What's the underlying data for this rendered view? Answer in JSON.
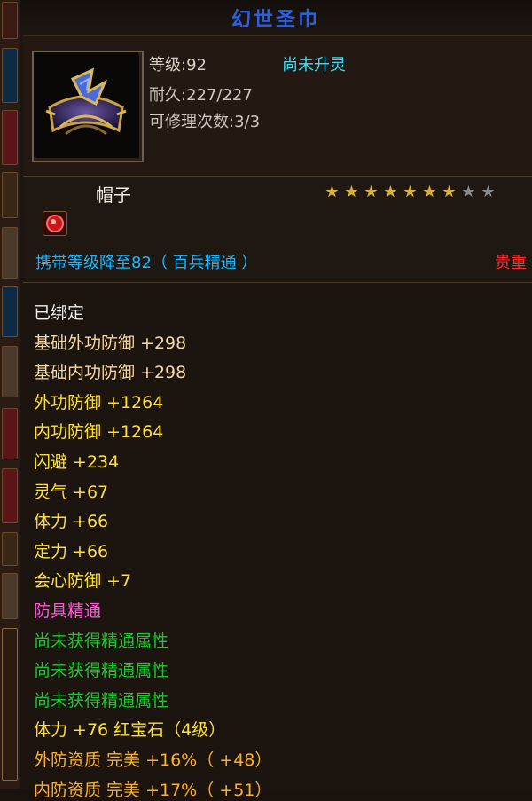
{
  "title": "幻世圣巾",
  "header": {
    "level": "等级:92",
    "spirit": "尚未升灵",
    "durability": "耐久:227/227",
    "repair": "可修理次数:3/3"
  },
  "item_type": "帽子",
  "stars": {
    "filled": 7,
    "total": 9
  },
  "carry_text": "携带等级降至82（ 百兵精通 ）",
  "precious": "贵重",
  "props": [
    {
      "text": "已绑定",
      "color": "white"
    },
    {
      "text": "基础外功防御  +298",
      "color": "wheat"
    },
    {
      "text": "基础内功防御  +298",
      "color": "wheat"
    },
    {
      "text": "外功防御  +1264",
      "color": "yellow"
    },
    {
      "text": "内功防御  +1264",
      "color": "yellow"
    },
    {
      "text": "闪避  +234",
      "color": "yellow"
    },
    {
      "text": "灵气  +67",
      "color": "yellow"
    },
    {
      "text": "体力  +66",
      "color": "yellow"
    },
    {
      "text": "定力  +66",
      "color": "yellow"
    },
    {
      "text": "会心防御  +7",
      "color": "yellow"
    },
    {
      "text": "防具精通",
      "color": "pink"
    },
    {
      "text": "尚未获得精通属性",
      "color": "green"
    },
    {
      "text": "尚未获得精通属性",
      "color": "green"
    },
    {
      "text": "尚未获得精通属性",
      "color": "green"
    },
    {
      "text": "体力  +76  红宝石（4级）",
      "color": "yellow"
    },
    {
      "text": "外防资质    完美  +16%（ +48）",
      "color": "orange"
    },
    {
      "text": "内防资质    完美  +17%（ +51）",
      "color": "orange"
    }
  ]
}
